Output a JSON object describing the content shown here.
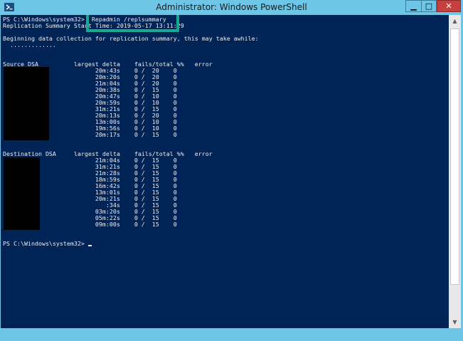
{
  "window": {
    "title": "Administrator: Windows PowerShell",
    "controls": {
      "minimize": "▁",
      "maximize": "□",
      "close": "✕"
    }
  },
  "console": {
    "lines": [
      "PS C:\\Windows\\system32>  Repadmin /replsummary",
      "Replication Summary Start Time: 2019-05-17 13:11:29",
      "",
      "Beginning data collection for replication summary, this may take awhile:",
      "  .............",
      "",
      "",
      "Source DSA          largest delta    fails/total %%   error",
      "                          20m:43s    0 /  20    0",
      "                          20m:20s    0 /  20    0",
      "                          21m:04s    0 /  20    0",
      "                          20m:38s    0 /  15    0",
      "                          20m:47s    0 /  10    0",
      "                          20m:59s    0 /  10    0",
      "                          31m:21s    0 /  15    0",
      "                          20m:13s    0 /  20    0",
      "                          13m:00s    0 /  10    0",
      "                          19m:56s    0 /  10    0",
      "                          20m:17s    0 /  15    0",
      "",
      "",
      "Destination DSA     largest delta    fails/total %%   error",
      "                          21m:04s    0 /  15    0",
      "                          31m:21s    0 /  15    0",
      "                          21m:28s    0 /  15    0",
      "                          18m:59s    0 /  15    0",
      "                          16m:42s    0 /  15    0",
      "                          13m:01s    0 /  15    0",
      "                          20m:21s    0 /  15    0",
      "                             :34s    0 /  15    0",
      "                          03m:20s    0 /  15    0",
      "                          05m:22s    0 /  15    0",
      "                          09m:00s    0 /  15    0",
      "",
      "",
      "PS C:\\Windows\\system32> "
    ]
  },
  "colors": {
    "console_bg": "#012456",
    "console_fg": "#eeedf0",
    "highlight_border": "#16a891",
    "titlebar": "#6ec6e6"
  }
}
